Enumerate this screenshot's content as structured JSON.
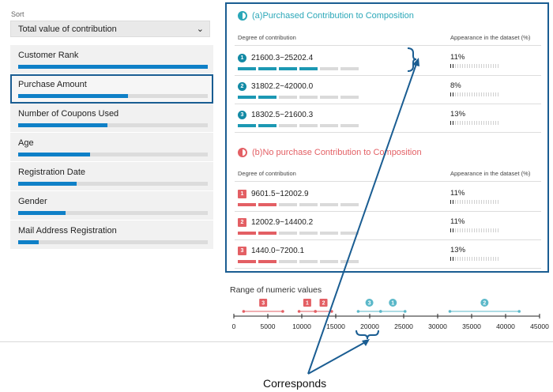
{
  "sort": {
    "label": "Sort",
    "selected": "Total value of contribution",
    "chevron_icon": "chevron-down-icon"
  },
  "attributes": [
    {
      "label": "Customer Rank",
      "value": 1.0
    },
    {
      "label": "Purchase Amount",
      "value": 0.58,
      "selected": true
    },
    {
      "label": "Number of Coupons Used",
      "value": 0.47
    },
    {
      "label": "Age",
      "value": 0.38
    },
    {
      "label": "Registration Date",
      "value": 0.31
    },
    {
      "label": "Gender",
      "value": 0.25
    },
    {
      "label": "Mail Address Registration",
      "value": 0.11
    }
  ],
  "panel": {
    "col_degree": "Degree of contribution",
    "col_appearance": "Appearance in the dataset (%)",
    "purchased": {
      "title": "(a)Purchased Contribution to Composition",
      "color": "#2aa7b8",
      "rows": [
        {
          "badge": "1",
          "range": "21600.3~25202.4",
          "filled": 4,
          "pct": "11%",
          "level": 0.11
        },
        {
          "badge": "2",
          "range": "31802.2~42000.0",
          "filled": 2,
          "pct": "8%",
          "level": 0.08
        },
        {
          "badge": "3",
          "range": "18302.5~21600.3",
          "filled": 2,
          "pct": "13%",
          "level": 0.13
        }
      ]
    },
    "no_purchase": {
      "title": "(b)No purchase Contribution to Composition",
      "color": "#e35f64",
      "rows": [
        {
          "badge": "1",
          "range": "9601.5~12002.9",
          "filled": 2,
          "pct": "11%",
          "level": 0.11
        },
        {
          "badge": "2",
          "range": "12002.9~14400.2",
          "filled": 2,
          "pct": "11%",
          "level": 0.11
        },
        {
          "badge": "3",
          "range": "1440.0~7200.1",
          "filled": 2,
          "pct": "13%",
          "level": 0.13
        }
      ]
    }
  },
  "range_axis": {
    "title": "Range of numeric values",
    "ticks": [
      "0",
      "5000",
      "10000",
      "15000",
      "20000",
      "25000",
      "30000",
      "35000",
      "40000",
      "45000"
    ],
    "tick_values": [
      0,
      5000,
      10000,
      15000,
      20000,
      25000,
      30000,
      35000,
      40000,
      45000
    ],
    "max": 45000,
    "purchased_ranges": [
      {
        "badge": "1",
        "from": 21600.3,
        "to": 25202.4
      },
      {
        "badge": "2",
        "from": 31802.2,
        "to": 42000.0
      },
      {
        "badge": "3",
        "from": 18302.5,
        "to": 21600.3
      }
    ],
    "no_purchase_ranges": [
      {
        "badge": "1",
        "from": 9601.5,
        "to": 12002.9
      },
      {
        "badge": "2",
        "from": 12002.9,
        "to": 14400.2
      },
      {
        "badge": "3",
        "from": 1440.0,
        "to": 7200.1
      }
    ]
  },
  "annotation": {
    "text": "Corresponds"
  }
}
